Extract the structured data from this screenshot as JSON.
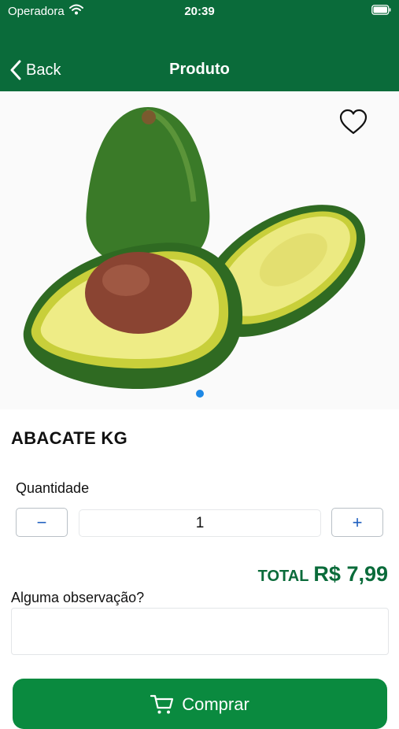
{
  "status_bar": {
    "carrier": "Operadora",
    "time": "20:39"
  },
  "nav": {
    "back_label": "Back",
    "title": "Produto"
  },
  "product": {
    "name": "ABACATE KG",
    "images_pages": 1,
    "current_page": 1
  },
  "quantity": {
    "label": "Quantidade",
    "value": "1",
    "minus": "−",
    "plus": "+"
  },
  "total": {
    "label": "TOTAL",
    "value": "R$ 7,99"
  },
  "observation": {
    "label": "Alguma observação?",
    "value": "",
    "placeholder": ""
  },
  "buy_button": {
    "label": "Comprar"
  },
  "colors": {
    "header": "#0a6b3a",
    "accent": "#0a8a3f",
    "page_dot": "#1e88e5",
    "stepper_text": "#1f5fbf"
  },
  "icons": {
    "back": "chevron-left-icon",
    "favorite": "heart-outline-icon",
    "buy": "cart-icon",
    "wifi": "wifi-icon",
    "battery": "battery-icon"
  }
}
